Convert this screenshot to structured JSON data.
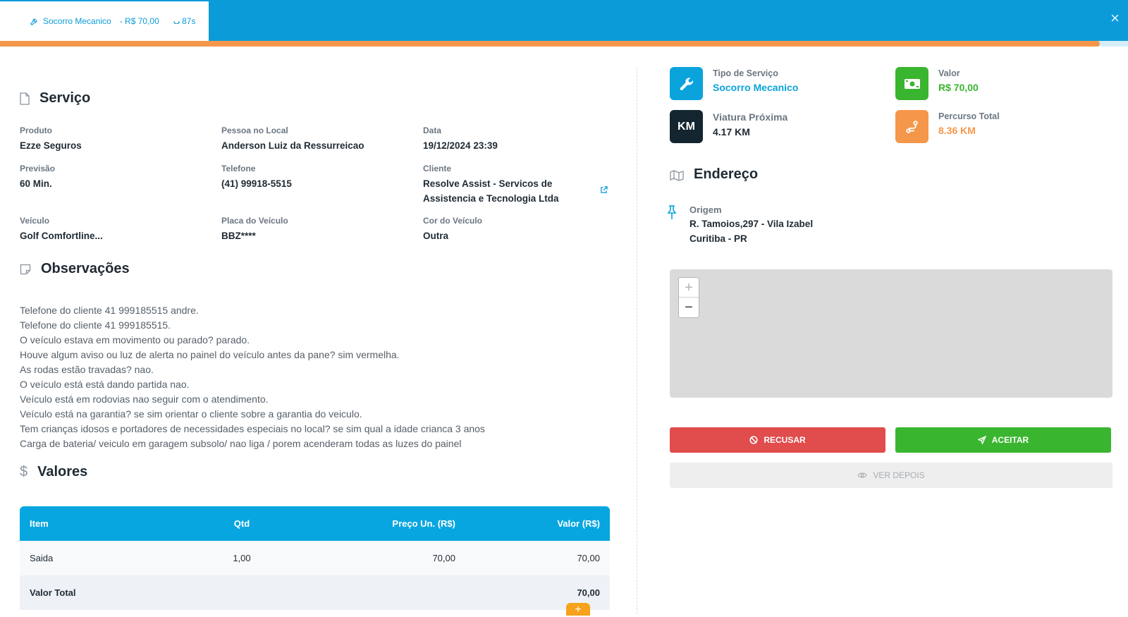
{
  "header": {
    "service_name": "Socorro Mecanico",
    "price": "- R$ 70,00",
    "timer": "87s",
    "close_label": "×",
    "progress_fraction": 0.975,
    "colors": {
      "bar": "#0a9bd8",
      "progress": "#f5974a"
    }
  },
  "servico": {
    "title": "Serviço",
    "icon": "document-icon",
    "fields": {
      "produto": {
        "label": "Produto",
        "value": "Ezze Seguros"
      },
      "pessoa": {
        "label": "Pessoa no Local",
        "value": "Anderson Luiz da Ressurreicao"
      },
      "data": {
        "label": "Data",
        "value": "19/12/2024 23:39"
      },
      "previsao": {
        "label": "Previsão",
        "value": "60 Min."
      },
      "telefone": {
        "label": "Telefone",
        "value": "(41) 99918-5515"
      },
      "cliente": {
        "label": "Cliente",
        "value_line1": "Resolve Assist - Servicos de",
        "value_line2": "Assistencia e Tecnologia Ltda"
      },
      "veiculo": {
        "label": "Veículo",
        "value": "Golf Comfortline..."
      },
      "placa": {
        "label": "Placa do Veículo",
        "value": "BBZ****"
      },
      "cor": {
        "label": "Cor do Veículo",
        "value": "Outra"
      }
    }
  },
  "observacoes": {
    "title": "Observações",
    "lines": [
      "Telefone do cliente 41 999185515 andre.",
      "Telefone do cliente 41 999185515.",
      "O veículo estava em movimento ou parado? parado.",
      "Houve algum aviso ou luz de alerta no painel do veículo antes da pane? sim vermelha.",
      "As rodas estão travadas? nao.",
      "O veículo está está dando partida nao.",
      "Veículo está em rodovias nao seguir com o atendimento.",
      "Veículo está na garantia? se sim orientar o cliente sobre a garantia do veiculo.",
      "Tem crianças idosos e portadores de necessidades especiais no local? se sim qual a idade crianca 3 anos",
      "Carga de bateria/ veiculo em garagem subsolo/ nao liga / porem acenderam todas as luzes do painel"
    ]
  },
  "valores": {
    "title": "Valores",
    "currency_symbol": "$",
    "headers": {
      "item": "Item",
      "qtd": "Qtd",
      "preco": "Preço Un. (R$)",
      "valor": "Valor (R$)"
    },
    "rows": [
      {
        "item": "Saida",
        "qtd": "1,00",
        "preco": "70,00",
        "valor": "70,00"
      }
    ],
    "total": {
      "label": "Valor Total",
      "value": "70,00"
    },
    "add_label": "+"
  },
  "cards": {
    "tipo": {
      "label": "Tipo de Serviço",
      "value": "Socorro Mecanico",
      "color": "#0aa3dc"
    },
    "valor": {
      "label": "Valor",
      "value": "R$ 70,00",
      "color": "#3ab52f"
    },
    "viatura": {
      "label": "Viatura Próxima",
      "value": "4.17 KM",
      "badge": "KM",
      "color": "#13262f"
    },
    "percurso": {
      "label": "Percurso Total",
      "value": "8.36 KM",
      "color": "#f5974a"
    }
  },
  "endereco": {
    "title": "Endereço",
    "origem_label": "Origem",
    "origem_line1": "R. Tamoios,297 - Vila Izabel",
    "origem_line2": "Curitiba - PR"
  },
  "map": {
    "zoom_in": "+",
    "zoom_out": "−"
  },
  "actions": {
    "refuse": "RECUSAR",
    "accept": "ACEITAR",
    "later": "VER DEPOIS"
  }
}
